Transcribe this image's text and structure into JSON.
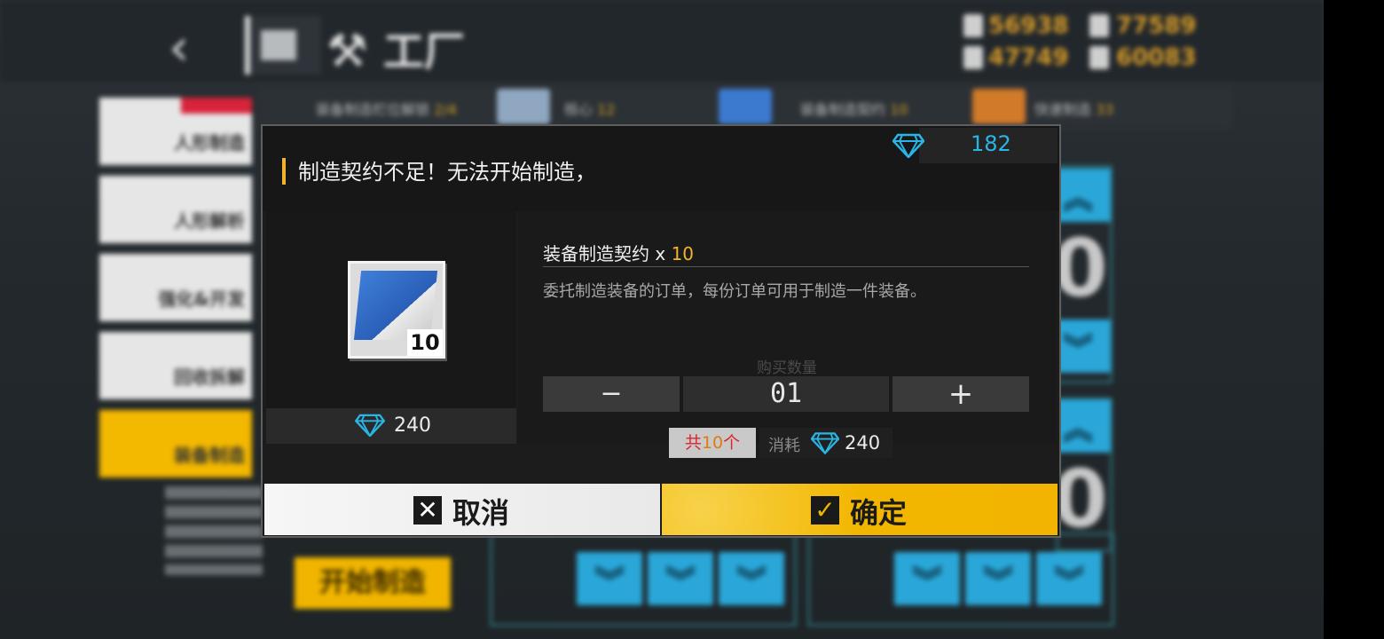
{
  "header": {
    "title": "工厂",
    "back_icon": "back-arrow-icon",
    "resources": [
      {
        "icon": "manpower-icon",
        "value": "56938"
      },
      {
        "icon": "ammo-icon",
        "value": "77589"
      },
      {
        "icon": "ration-icon",
        "value": "47749"
      },
      {
        "icon": "parts-icon",
        "value": "60083"
      }
    ]
  },
  "subbar": {
    "slot_label": "装备制造栏位解锁",
    "slot_value": "2/4",
    "core_label": "核心",
    "core_value": "12",
    "contract_label": "装备制造契约",
    "contract_value": "10",
    "quick_label": "快速制造",
    "quick_value": "33"
  },
  "sidebar": [
    {
      "label": "人形制造"
    },
    {
      "label": "人形解析"
    },
    {
      "label": "强化&开发"
    },
    {
      "label": "回收拆解"
    },
    {
      "label": "装备制造",
      "active": true
    }
  ],
  "background": {
    "start_button": "开始制造",
    "zero_a": "0",
    "zero_b": "0"
  },
  "modal": {
    "message": "制造契约不足！无法开始制造，",
    "gem_balance": "182",
    "item": {
      "name": "装备制造契约",
      "multiplier_prefix": "x",
      "multiplier": "10",
      "icon_qty": "10",
      "price": "240",
      "description": "委托制造装备的订单，每份订单可用于制造一件装备。"
    },
    "quantity_label": "购买数量",
    "quantity_value": "01",
    "minus_symbol": "−",
    "plus_symbol": "+",
    "total_prefix": "共",
    "total_count": "10",
    "total_suffix": "个",
    "consume_label": "消耗",
    "consume_value": "240",
    "cancel_label": "取消",
    "confirm_label": "确定"
  },
  "colors": {
    "accent_yellow": "#f3b600",
    "gem_cyan": "#29b6e6",
    "warning_red": "#d8282d"
  }
}
